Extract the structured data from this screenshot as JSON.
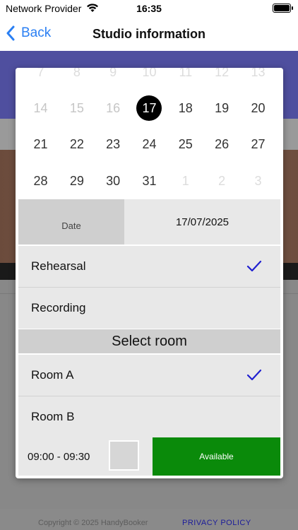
{
  "status_bar": {
    "carrier": "Network Provider",
    "time": "16:35",
    "icons": [
      "wifi-icon",
      "battery-icon"
    ]
  },
  "nav": {
    "back_label": "Back",
    "title": "Studio information",
    "back_icon": "chevron-left-icon"
  },
  "calendar": {
    "selected_day": "17",
    "rows": [
      [
        {
          "d": "7",
          "s": "faint"
        },
        {
          "d": "8",
          "s": "faint"
        },
        {
          "d": "9",
          "s": "faint"
        },
        {
          "d": "10",
          "s": "faint"
        },
        {
          "d": "11",
          "s": "faint"
        },
        {
          "d": "12",
          "s": "faint"
        },
        {
          "d": "13",
          "s": "faint"
        }
      ],
      [
        {
          "d": "14",
          "s": "faded"
        },
        {
          "d": "15",
          "s": "faded"
        },
        {
          "d": "16",
          "s": "faded"
        },
        {
          "d": "17",
          "s": "selected"
        },
        {
          "d": "18",
          "s": "normal"
        },
        {
          "d": "19",
          "s": "normal"
        },
        {
          "d": "20",
          "s": "normal"
        }
      ],
      [
        {
          "d": "21",
          "s": "normal"
        },
        {
          "d": "22",
          "s": "normal"
        },
        {
          "d": "23",
          "s": "normal"
        },
        {
          "d": "24",
          "s": "normal"
        },
        {
          "d": "25",
          "s": "normal"
        },
        {
          "d": "26",
          "s": "normal"
        },
        {
          "d": "27",
          "s": "normal"
        }
      ],
      [
        {
          "d": "28",
          "s": "normal"
        },
        {
          "d": "29",
          "s": "normal"
        },
        {
          "d": "30",
          "s": "normal"
        },
        {
          "d": "31",
          "s": "normal"
        },
        {
          "d": "1",
          "s": "faint"
        },
        {
          "d": "2",
          "s": "faint"
        },
        {
          "d": "3",
          "s": "faint"
        }
      ]
    ]
  },
  "date_row": {
    "label": "Date",
    "value": "17/07/2025"
  },
  "session_types": {
    "rehearsal": "Rehearsal",
    "recording": "Recording",
    "selected": "Rehearsal"
  },
  "room_section": {
    "header": "Select room",
    "room_a": "Room A",
    "room_b": "Room B",
    "selected": "Room A"
  },
  "slot": {
    "time": "09:00 - 09:30",
    "status": "Available"
  },
  "footer": {
    "copyright": "Copyright © 2025 HandyBooker",
    "privacy": "PRIVACY POLICY"
  },
  "colors": {
    "accent_blue": "#2a7ff3",
    "header_blue": "#1f1fb0",
    "check_blue": "#1f1fd0",
    "available_green": "#0a8a0a"
  }
}
